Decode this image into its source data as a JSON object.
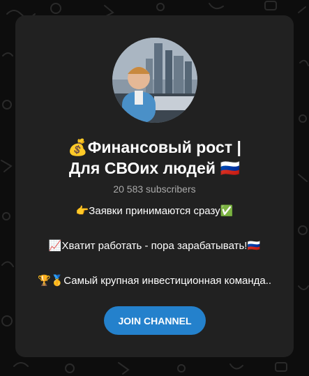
{
  "channel": {
    "title_line1": "💰Финансовый рост |",
    "title_line2": "Для СВОих людей 🇷🇺",
    "subscribers": "20 583 subscribers",
    "description": [
      "👉Заявки принимаются сразу✅",
      "📈Хватит работать - пора зарабатывать!🇷🇺",
      "🏆🥇Самый крупная инвестиционная команда.."
    ],
    "join_label": "JOIN CHANNEL"
  },
  "colors": {
    "card_background": "#212121",
    "page_background": "#0d0d0d",
    "button": "#2481cc",
    "subscribers_text": "#aaaaaa"
  },
  "icons": {
    "background": "doodle-pattern",
    "avatar": "channel-avatar-photo"
  }
}
